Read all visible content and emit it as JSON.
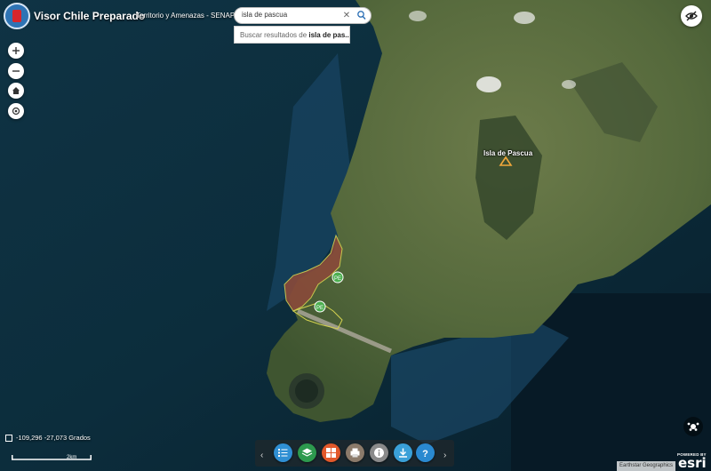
{
  "header": {
    "title": "Visor Chile Preparado",
    "subtitle": "Territorio y Amenazas - SENAPRED"
  },
  "search": {
    "value": "isla de pascua",
    "suggestion_prefix": "Buscar resultados de ",
    "suggestion_term": "isla de pas..."
  },
  "map": {
    "place_label": "Isla de Pascua",
    "marker_labels": [
      "PE",
      "PE"
    ],
    "coordinates": "-109,296 -27,073 Grados",
    "scale_label": "2km",
    "attribution": "Earthstar Geographics",
    "esri_powered": "POWERED BY",
    "esri_brand": "esri"
  },
  "toolbar": {
    "colors": [
      "#2f8fd3",
      "#2d9a4e",
      "#e2582a",
      "#8b7a6a",
      "#8a8a8a",
      "#3aa0d8",
      "#2a89d0"
    ],
    "icons": [
      "legend-icon",
      "layers-icon",
      "basemap-gallery-icon",
      "print-icon",
      "info-icon",
      "download-icon",
      "help-icon"
    ]
  },
  "colors": {
    "ocean": "#0b2a3a",
    "land": "#4f6a3a",
    "hazard": "#8a4a3a",
    "accent": "#e2a83a"
  }
}
